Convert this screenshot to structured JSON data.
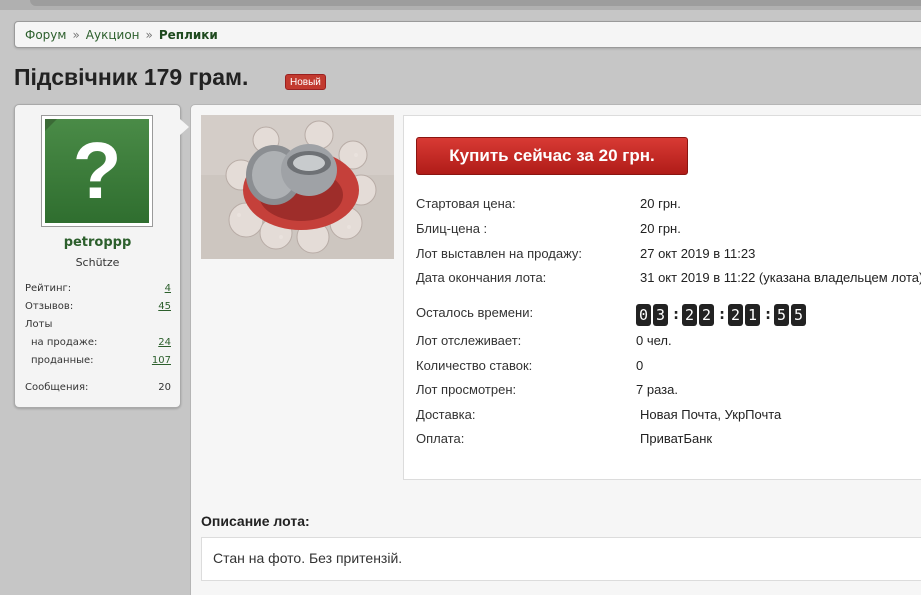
{
  "breadcrumb": {
    "items": [
      "Форум",
      "Аукцион"
    ],
    "current": "Реплики",
    "separator": "»"
  },
  "page": {
    "title": "Підсвічник 179 грам.",
    "badge": "Новый"
  },
  "user": {
    "name": "petroppp",
    "title": "Schütze",
    "stats": {
      "rating_label": "Рейтинг:",
      "rating": "4",
      "reviews_label": "Отзывов:",
      "reviews": "45",
      "lots_label": "Лоты",
      "on_sale_label": "на продаже:",
      "on_sale": "24",
      "sold_label": "проданные:",
      "sold": "107",
      "messages_label": "Сообщения:",
      "messages": "20"
    }
  },
  "lot": {
    "buy_button": "Купить сейчас за 20 грн.",
    "start_price_label": "Стартовая цена:",
    "start_price": "20 грн.",
    "blitz_label": "Блиц-цена :",
    "blitz": "20 грн.",
    "listed_label": "Лот выставлен на продажу:",
    "listed": "27 окт 2019 в 11:23",
    "end_label": "Дата окончания лота:",
    "end": "31 окт 2019 в 11:22 (указана владельцем лота)",
    "time_left_label": "Осталось времени:",
    "countdown": {
      "h1": "0",
      "h2": "3",
      "m1": "2",
      "m2": "2",
      "s1": "2",
      "s2": "1",
      "f1": "5",
      "f2": "5"
    },
    "watchers_label": "Лот отслеживает:",
    "watchers": "0 чел.",
    "bids_label": "Количество ставок:",
    "bids": "0",
    "views_label": "Лот просмотрен:",
    "views": "7 раза.",
    "delivery_label": "Доставка:",
    "delivery": "Новая Почта, УкрПочта",
    "payment_label": "Оплата:",
    "payment": "ПриватБанк"
  },
  "description": {
    "title": "Описание лота:",
    "text": "Стан на фото. Без притензій."
  },
  "colors": {
    "accent": "#2c5f2c",
    "buy": "#c4221c",
    "badge": "#c23a2f"
  }
}
